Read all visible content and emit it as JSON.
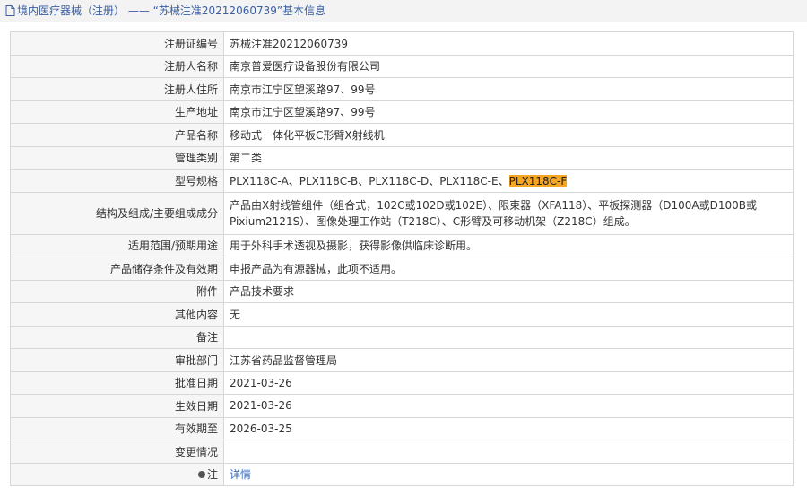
{
  "header": {
    "section": "境内医疗器械（注册）",
    "separator": "——",
    "title": "“苏械注准20212060739”基本信息"
  },
  "rows": [
    {
      "label": "注册证编号",
      "value": "苏械注准20212060739"
    },
    {
      "label": "注册人名称",
      "value": "南京普爱医疗设备股份有限公司"
    },
    {
      "label": "注册人住所",
      "value": "南京市江宁区望溪路97、99号"
    },
    {
      "label": "生产地址",
      "value": "南京市江宁区望溪路97、99号"
    },
    {
      "label": "产品名称",
      "value": "移动式一体化平板C形臂X射线机"
    },
    {
      "label": "管理类别",
      "value": "第二类"
    },
    {
      "label": "型号规格",
      "value_prefix": "PLX118C-A、PLX118C-B、PLX118C-D、PLX118C-E、",
      "value_highlight": "PLX118C-F"
    },
    {
      "label": "结构及组成/主要组成成分",
      "value": "产品由X射线管组件（组合式，102C或102D或102E）、限束器（XFA118）、平板探测器（D100A或D100B或Pixium2121S）、图像处理工作站（T218C）、C形臂及可移动机架（Z218C）组成。"
    },
    {
      "label": "适用范围/预期用途",
      "value": "用于外科手术透视及摄影，获得影像供临床诊断用。"
    },
    {
      "label": "产品储存条件及有效期",
      "value": "申报产品为有源器械，此项不适用。"
    },
    {
      "label": "附件",
      "value": "产品技术要求"
    },
    {
      "label": "其他内容",
      "value": "无"
    },
    {
      "label": "备注",
      "value": ""
    },
    {
      "label": "审批部门",
      "value": "江苏省药品监督管理局"
    },
    {
      "label": "批准日期",
      "value": "2021-03-26"
    },
    {
      "label": "生效日期",
      "value": "2021-03-26"
    },
    {
      "label": "有效期至",
      "value": "2026-03-25"
    },
    {
      "label": "变更情况",
      "value": ""
    },
    {
      "label": "注",
      "value": "详情"
    }
  ]
}
